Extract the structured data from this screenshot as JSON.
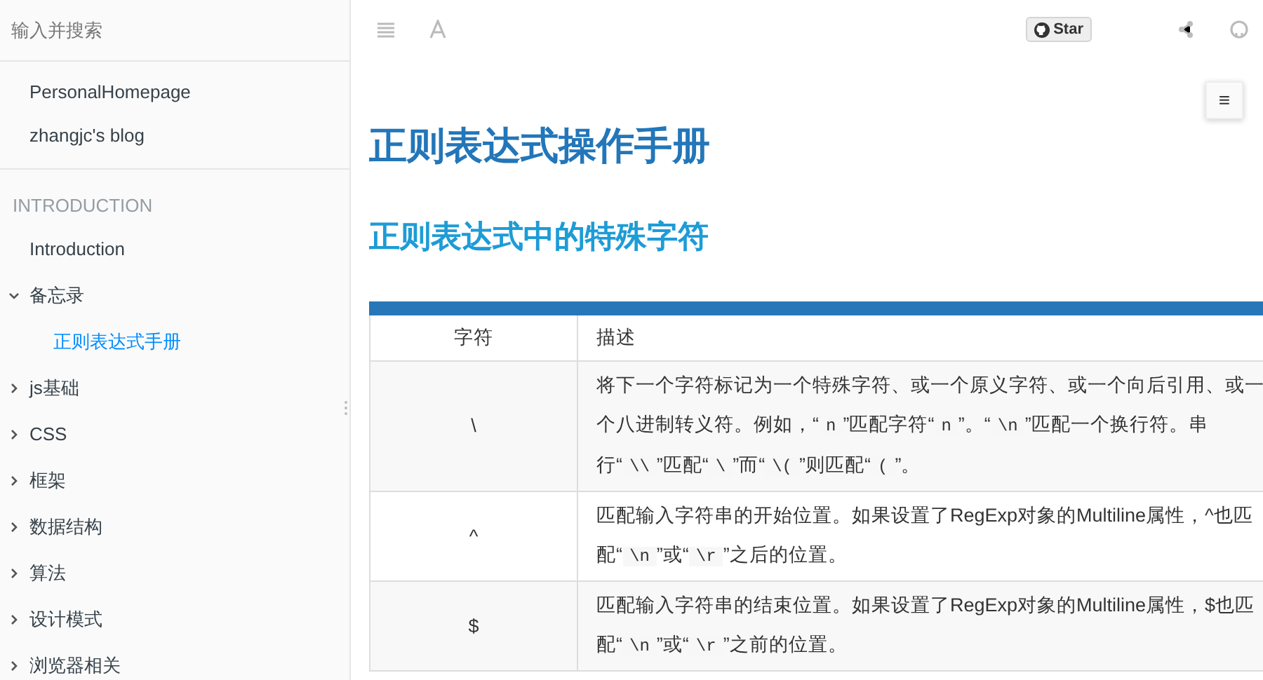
{
  "sidebar": {
    "search": {
      "placeholder": "输入并搜索"
    },
    "links": [
      "PersonalHomepage",
      "zhangjc's blog"
    ],
    "section": "INTRODUCTION",
    "items": [
      {
        "label": "Introduction",
        "selected": false
      },
      {
        "label": "备忘录",
        "selected": false,
        "expanded": true,
        "children": [
          {
            "label": "正则表达式手册",
            "selected": true
          }
        ]
      },
      {
        "label": "js基础",
        "selected": false,
        "expanded": false
      },
      {
        "label": "CSS",
        "selected": false,
        "expanded": false
      },
      {
        "label": "框架",
        "selected": false,
        "expanded": false
      },
      {
        "label": "数据结构",
        "selected": false,
        "expanded": false
      },
      {
        "label": "算法",
        "selected": false,
        "expanded": false
      },
      {
        "label": "设计模式",
        "selected": false,
        "expanded": false
      },
      {
        "label": "浏览器相关",
        "selected": false,
        "expanded": false
      }
    ]
  },
  "toolbar": {
    "star_button": "Star"
  },
  "toc_button": "≡",
  "content": {
    "title": "正则表达式操作手册",
    "subtitle": "正则表达式中的特殊字符",
    "table": {
      "columns": [
        "字符",
        "描述"
      ],
      "rows": [
        {
          "char": "\\",
          "description": [
            {
              "kind": "text",
              "text": "将下一个字符标记为一个特殊字符、或一个原义字符、或一个向后引用、或一个八进制转义符。例如，“"
            },
            {
              "kind": "code",
              "text": "n"
            },
            {
              "kind": "text",
              "text": "”匹配字符“"
            },
            {
              "kind": "code",
              "text": "n"
            },
            {
              "kind": "text",
              "text": "”。“"
            },
            {
              "kind": "code",
              "text": "\\n"
            },
            {
              "kind": "text",
              "text": "”匹配一个换行符。串行“"
            },
            {
              "kind": "code",
              "text": "\\\\"
            },
            {
              "kind": "text",
              "text": "”匹配“"
            },
            {
              "kind": "code",
              "text": "\\"
            },
            {
              "kind": "text",
              "text": "”而“"
            },
            {
              "kind": "code",
              "text": "\\("
            },
            {
              "kind": "text",
              "text": "”则匹配“"
            },
            {
              "kind": "code",
              "text": "("
            },
            {
              "kind": "text",
              "text": "”。"
            }
          ]
        },
        {
          "char": "^",
          "description": [
            {
              "kind": "text",
              "text": "匹配输入字符串的开始位置。如果设置了RegExp对象的Multiline属性，^也匹配“"
            },
            {
              "kind": "code",
              "text": "\\n"
            },
            {
              "kind": "text",
              "text": "”或“"
            },
            {
              "kind": "code",
              "text": "\\r"
            },
            {
              "kind": "text",
              "text": "”之后的位置。"
            }
          ]
        },
        {
          "char": "$",
          "description": [
            {
              "kind": "text",
              "text": "匹配输入字符串的结束位置。如果设置了RegExp对象的Multiline属性，$也匹配“"
            },
            {
              "kind": "code",
              "text": "\\n"
            },
            {
              "kind": "text",
              "text": "”或“"
            },
            {
              "kind": "code",
              "text": "\\r"
            },
            {
              "kind": "text",
              "text": "”之前的位置。"
            }
          ]
        }
      ]
    }
  }
}
